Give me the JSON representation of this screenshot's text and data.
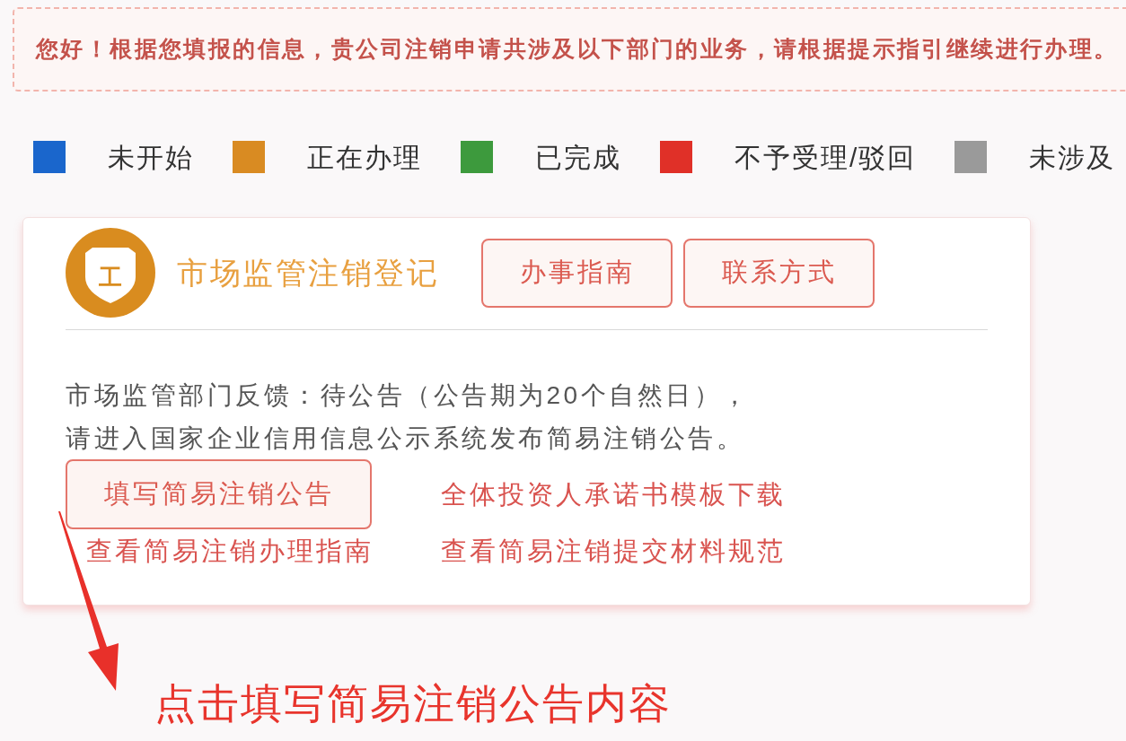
{
  "notice": {
    "text": "您好！根据您填报的信息，贵公司注销申请共涉及以下部门的业务，请根据提示指引继续进行办理。"
  },
  "legend": [
    {
      "label": "未开始",
      "color": "#1a66cc"
    },
    {
      "label": "正在办理",
      "color": "#d98b22"
    },
    {
      "label": "已完成",
      "color": "#3d9a3d"
    },
    {
      "label": "不予受理/驳回",
      "color": "#e03028"
    },
    {
      "label": "未涉及",
      "color": "#9a9a9a"
    }
  ],
  "card": {
    "logo_glyph": "工",
    "title": "市场监管注销登记",
    "header_buttons": [
      "办事指南",
      "联系方式"
    ],
    "feedback_lines": [
      "市场监管部门反馈：待公告（公告期为20个自然日），",
      "请进入国家企业信用信息公示系统发布简易注销公告。"
    ],
    "actions": [
      {
        "kind": "button",
        "label": "填写简易注销公告"
      },
      {
        "kind": "link",
        "label": "全体投资人承诺书模板下载"
      },
      {
        "kind": "link",
        "label": "查看简易注销办理指南"
      },
      {
        "kind": "link",
        "label": "查看简易注销提交材料规范"
      }
    ]
  },
  "annotation": {
    "text": "点击填写简易注销公告内容"
  }
}
